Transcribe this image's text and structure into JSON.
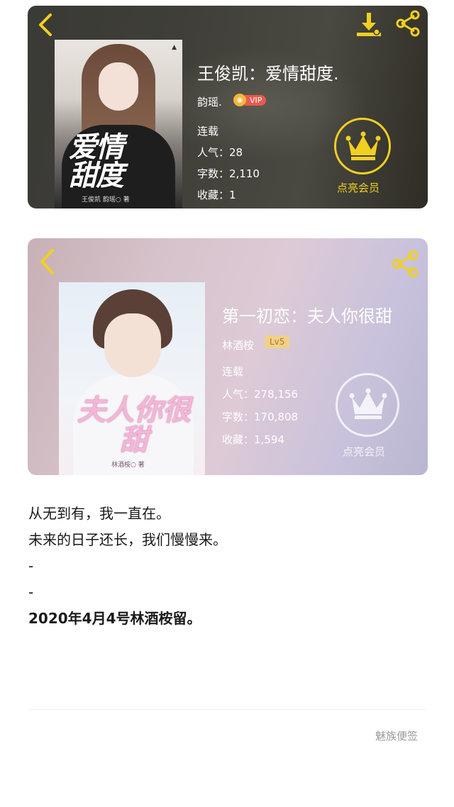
{
  "card1": {
    "title": "王俊凯：爱情甜度.",
    "author": "韵瑶.",
    "vip_label": "VIP",
    "status": "连载",
    "popularity": "人气：28",
    "word_count": "字数：2,110",
    "favorites": "收藏：1",
    "member_label": "点亮会员",
    "cover_title": "爱情甜度",
    "cover_byline": "王俊凯  韵瑶○ 著",
    "colors": {
      "crown": "#f1d021",
      "vip": "#e95b4d"
    }
  },
  "card2": {
    "title": "第一初恋：夫人你很甜",
    "author": "林酒桉",
    "level": "Lv5",
    "status": "连载",
    "popularity": "人气：278,156",
    "word_count": "字数：170,808",
    "favorites": "收藏：1,594",
    "member_label": "点亮会员",
    "cover_title": "夫人你很甜",
    "cover_byline": "林酒桉○ 著",
    "colors": {
      "level_bg": "#f1d08a"
    }
  },
  "note": {
    "lines": [
      "从无到有，我一直在。",
      "未来的日子还长，我们慢慢来。",
      "-",
      "-",
      "2020年4月4号林酒桉留。"
    ]
  },
  "footer": {
    "app_label": "魅族便签"
  }
}
